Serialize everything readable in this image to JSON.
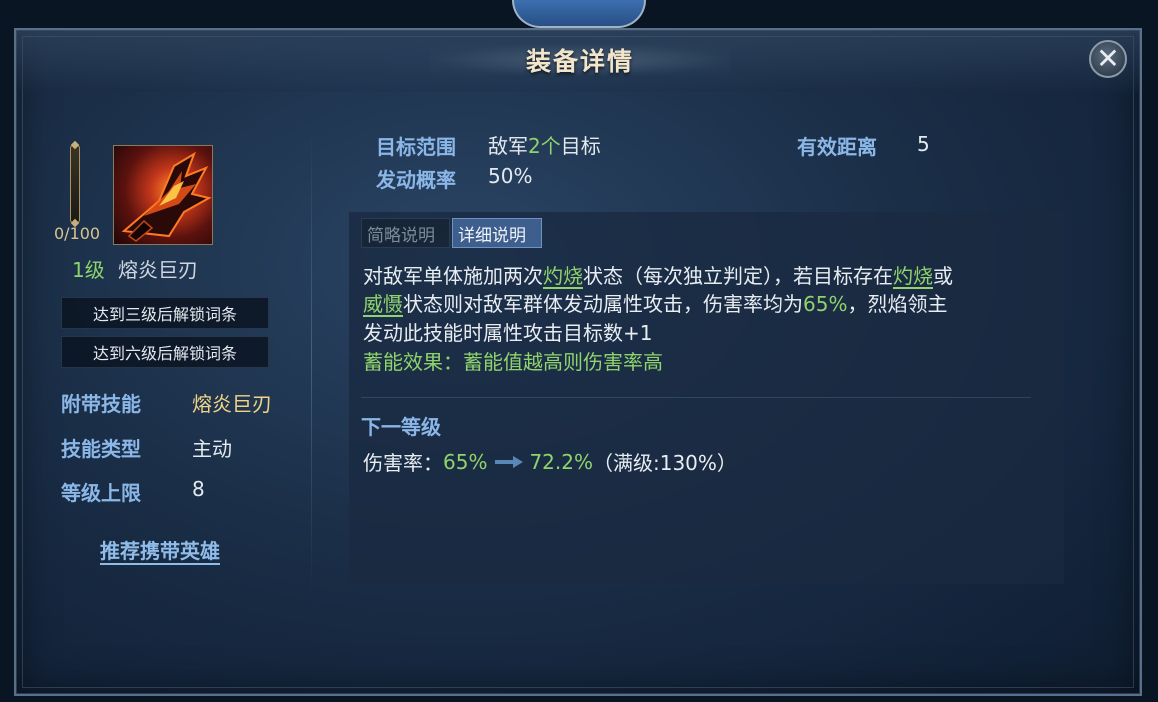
{
  "header": {
    "title": "装备详情"
  },
  "item": {
    "progress": "0/100",
    "level": "1级",
    "name": "熔炎巨刃",
    "unlock_lines": [
      "达到三级后解锁词条",
      "达到六级后解锁词条"
    ],
    "attributes": [
      {
        "label": "附带技能",
        "value": "熔炎巨刃"
      },
      {
        "label": "技能类型",
        "value": "主动"
      },
      {
        "label": "等级上限",
        "value": "8"
      }
    ],
    "recommend_link": "推荐携带英雄"
  },
  "stats": {
    "target_range_label": "目标范围",
    "target_range_prefix": "敌军",
    "target_range_count": "2个",
    "target_range_suffix": "目标",
    "distance_label": "有效距离",
    "distance_value": "5",
    "trigger_label": "发动概率",
    "trigger_value": "50%"
  },
  "tabs": {
    "brief": "简略说明",
    "detail": "详细说明",
    "active": "detail"
  },
  "description": {
    "l1_a": "对敌军单体施加两次",
    "kw_burn": "灼烧",
    "l1_b": "状态（每次独立判定），若目标存在",
    "l1_c": "或",
    "kw_deter": "威慑",
    "l2_a": "状态则对敌军群体发动属性攻击，伤害率均为",
    "l2_pct": "65%",
    "l2_b": "，烈焰领主",
    "l3": "发动此技能时属性攻击目标数+1",
    "l4": "蓄能效果：蓄能值越高则伤害率高"
  },
  "next_level": {
    "title": "下一等级",
    "label": "伤害率：",
    "current": "65%",
    "next": "72.2%",
    "max": "（满级:130%）"
  },
  "colors": {
    "accent_green": "#8fd36c",
    "label_blue": "#8bb7e8",
    "gold": "#f0d488"
  }
}
